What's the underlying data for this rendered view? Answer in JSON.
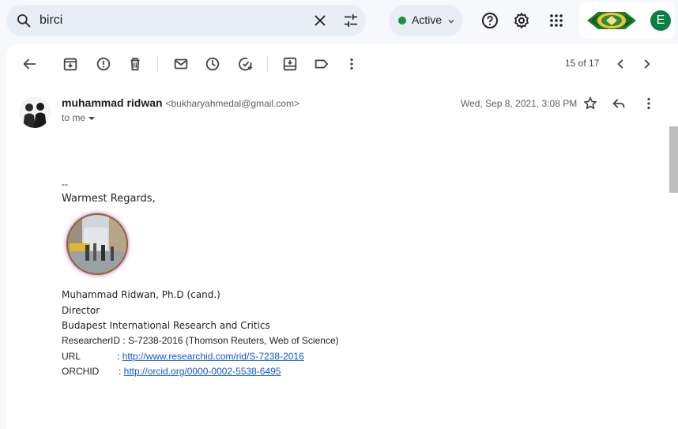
{
  "search": {
    "value": "birci",
    "icon": "search-icon"
  },
  "status": {
    "label": "Active",
    "color": "#1e8e3e"
  },
  "account": {
    "initial": "E",
    "avatar_color": "#0b8043"
  },
  "pager": {
    "text": "15 of 17"
  },
  "email": {
    "sender_name": "muhammad ridwan",
    "sender_email": "<bukharyahmedal@gmail.com>",
    "to": "to me",
    "date": "Wed, Sep 8, 2021, 3:08 PM",
    "body": {
      "separator": "--",
      "greeting": "Warmest Regards,",
      "name": "Muhammad Ridwan, Ph.D (cand.)",
      "title": "Director",
      "org": "Budapest International Research and Critics",
      "researcher_id": "ResearcherID : S-7238-2016 (Thomson Reuters, Web of Science)",
      "url_label": "URL",
      "url_sep": ": ",
      "url": "http://www.researchid.com/rid/S-7238-2016",
      "orcid_label": "ORCHID",
      "orcid_sep": ": ",
      "orcid": "http://orcid.org/0000-0002-5538-6495"
    }
  }
}
